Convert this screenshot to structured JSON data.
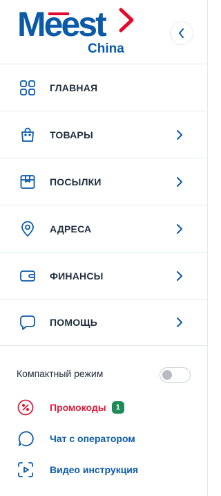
{
  "brand": {
    "logo_text": "Meest",
    "logo_subtext": "China",
    "colors": {
      "blue": "#0a5aa8",
      "red": "#e30a2c"
    }
  },
  "collapse_button": {
    "icon": "chevron-left-icon"
  },
  "nav": {
    "items": [
      {
        "label": "ГЛАВНАЯ",
        "icon": "grid-icon",
        "has_chevron": false
      },
      {
        "label": "ТОВАРЫ",
        "icon": "shopping-bag-icon",
        "has_chevron": true
      },
      {
        "label": "ПОСЫЛКИ",
        "icon": "package-icon",
        "has_chevron": true
      },
      {
        "label": "АДРЕСА",
        "icon": "location-pin-icon",
        "has_chevron": true
      },
      {
        "label": "ФИНАНСЫ",
        "icon": "wallet-icon",
        "has_chevron": true
      },
      {
        "label": "ПОМОЩЬ",
        "icon": "chat-bubble-icon",
        "has_chevron": true
      }
    ]
  },
  "compact_mode": {
    "label": "Компактный режим",
    "enabled": false
  },
  "links": {
    "promo": {
      "label": "Промокоды",
      "badge": "1",
      "color": "#d41f3c",
      "icon": "percent-icon"
    },
    "chat": {
      "label": "Чат с оператором",
      "color": "#0a5aa8",
      "icon": "chat-icon"
    },
    "video": {
      "label": "Видео инструкция",
      "color": "#0a5aa8",
      "icon": "video-icon"
    }
  }
}
